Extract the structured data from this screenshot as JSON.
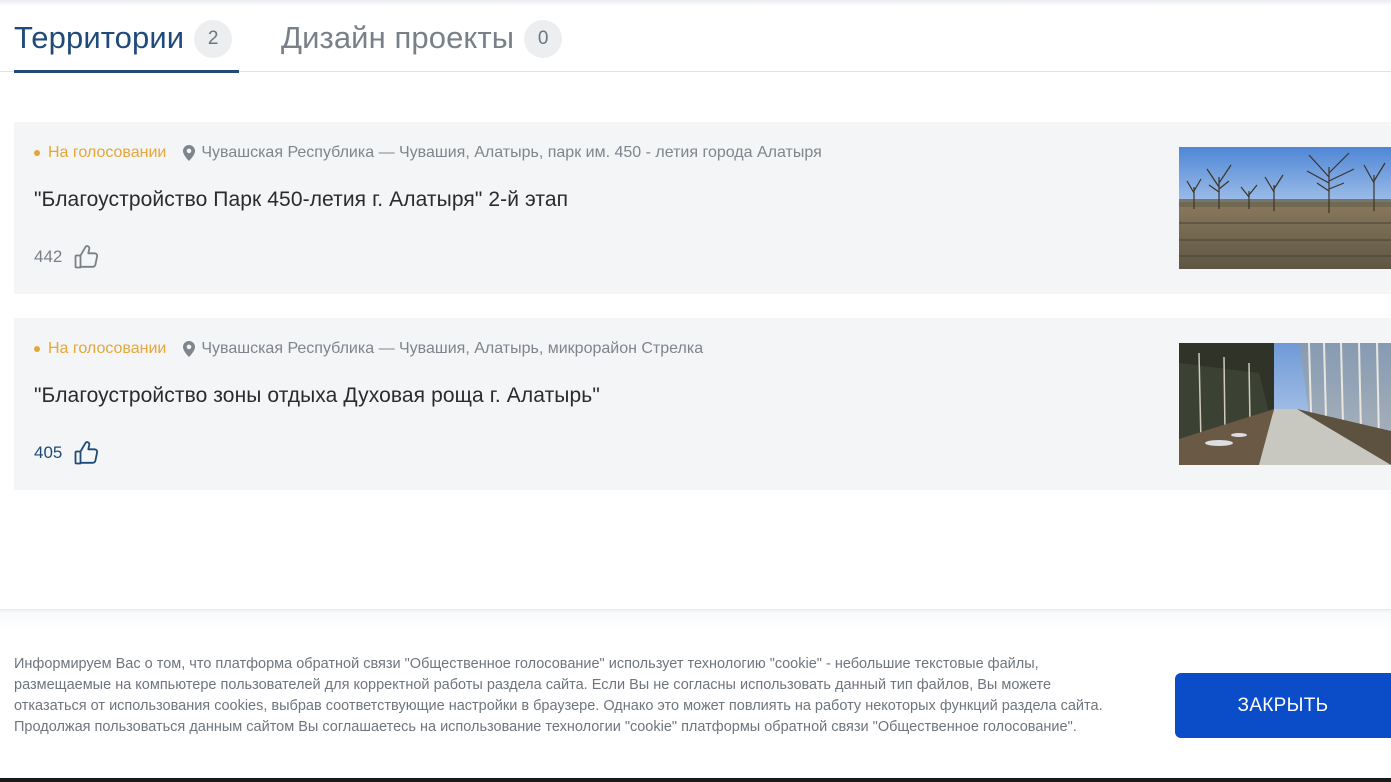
{
  "tabs": [
    {
      "label": "Территории",
      "count": "2",
      "active": true
    },
    {
      "label": "Дизайн проекты",
      "count": "0",
      "active": false
    }
  ],
  "projects": [
    {
      "status": "На голосовании",
      "location": "Чувашская Республика — Чувашия, Алатырь, парк им. 450 - летия города Алатыря",
      "title": "\"Благоустройство Парк 450-летия г. Алатыря\" 2-й этап",
      "likes": "442",
      "image": "park-trees-photo"
    },
    {
      "status": "На голосовании",
      "location": "Чувашская Республика — Чувашия, Алатырь, микрорайон Стрелка",
      "title": "\"Благоустройство зоны отдыха Духовая роща г. Алатырь\"",
      "likes": "405",
      "image": "birch-alley-photo"
    }
  ],
  "cookie": {
    "text": "Информируем Вас о том, что платформа обратной связи \"Общественное голосование\" использует технологию \"cookie\" - небольшие текстовые файлы, размещаемые на компьютере пользователей для корректной работы раздела сайта. Если Вы не согласны использовать данный тип файлов, Вы можете отказаться от использования cookies, выбрав соответствующие настройки в браузере. Однако это может повлиять на работу некоторых функций раздела сайта. Продолжая пользоваться данным сайтом Вы соглашаетесь на использование технологии \"cookie\" платформы обратной связи \"Общественное голосование\".",
    "button_label": "ЗАКРЫТЬ"
  },
  "colors": {
    "accent": "#1f4a7a",
    "status": "#e5a63a",
    "button": "#0b4dc8"
  }
}
